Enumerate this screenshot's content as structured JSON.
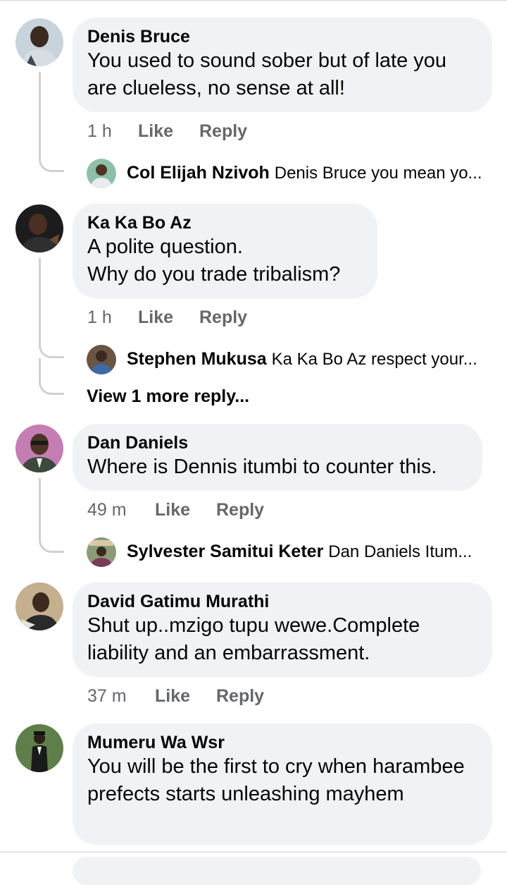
{
  "comments": [
    {
      "author": "Denis Bruce",
      "text": "You used to sound sober but of late you are clueless, no sense at all!",
      "time": "1 h",
      "like": "Like",
      "reply": "Reply",
      "avatar_icon": "person-avatar",
      "avatar_color": "#b7c3cf",
      "replies": [
        {
          "author": "Col Elijah Nzivoh",
          "text": "Denis Bruce you mean yo...",
          "avatar_color": "#7fae9a"
        }
      ]
    },
    {
      "author": "Ka Ka Bo Az",
      "text": "A polite question.\nWhy do you trade tribalism?",
      "time": "1 h",
      "like": "Like",
      "reply": "Reply",
      "avatar_color": "#2a2a2a",
      "replies": [
        {
          "author": "Stephen Mukusa",
          "text": "Ka Ka Bo Az respect your...",
          "avatar_color": "#5b4a3a"
        }
      ],
      "view_more": "View 1 more reply..."
    },
    {
      "author": "Dan Daniels",
      "text": "Where is Dennis itumbi to counter this.",
      "time": "49 m",
      "like": "Like",
      "reply": "Reply",
      "avatar_color": "#b56aa0",
      "replies": [
        {
          "author": "Sylvester Samitui Keter",
          "text": "Dan Daniels Itum...",
          "avatar_color": "#6d7a5e"
        }
      ]
    },
    {
      "author": "David Gatimu Murathi",
      "text": "Shut up..mzigo tupu wewe.Complete liability and an embarrassment.",
      "time": "37 m",
      "like": "Like",
      "reply": "Reply",
      "avatar_color": "#a08c6e"
    },
    {
      "author": "Mumeru Wa Wsr",
      "text": "You will be the first to cry when harambee prefects starts unleashing mayhem",
      "avatar_color": "#4f6b3f"
    }
  ],
  "colors": {
    "bubble": "#f0f2f5",
    "meta": "#65676b",
    "thread": "#ced0d4"
  }
}
